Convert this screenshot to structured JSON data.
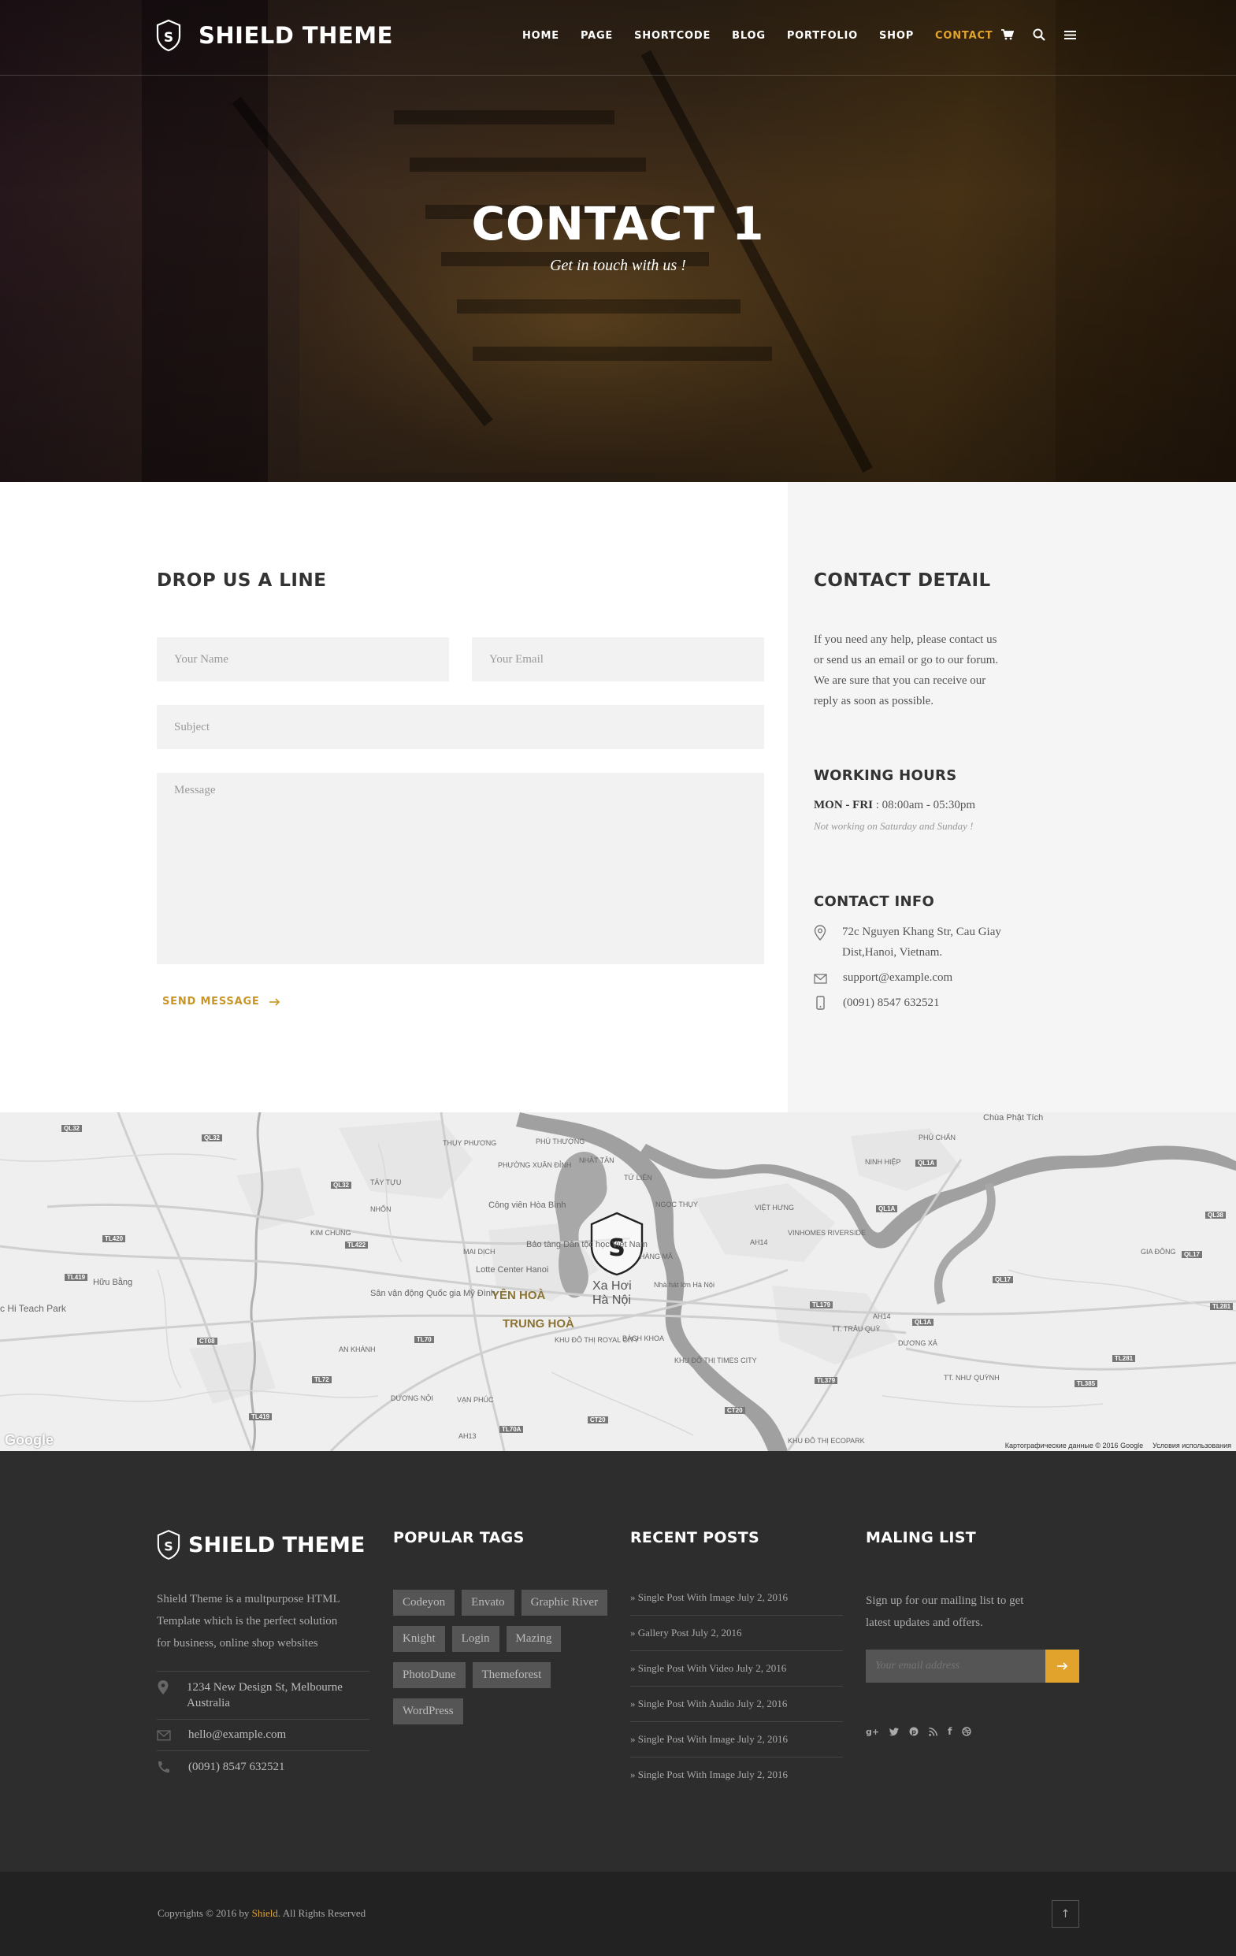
{
  "header": {
    "brand": "SHIELD THEME",
    "nav": [
      {
        "label": "HOME",
        "active": false
      },
      {
        "label": "PAGE",
        "active": false
      },
      {
        "label": "SHORTCODE",
        "active": false
      },
      {
        "label": "BLOG",
        "active": false
      },
      {
        "label": "PORTFOLIO",
        "active": false
      },
      {
        "label": "SHOP",
        "active": false
      },
      {
        "label": "CONTACT",
        "active": true
      }
    ],
    "icons": [
      "cart-icon",
      "search-icon",
      "menu-icon"
    ]
  },
  "hero": {
    "title": "CONTACT 1",
    "subtitle": "Get in touch with us !"
  },
  "form": {
    "heading": "DROP US A LINE",
    "name_placeholder": "Your Name",
    "email_placeholder": "Your Email",
    "subject_placeholder": "Subject",
    "message_placeholder": "Message",
    "send_label": "SEND MESSAGE"
  },
  "contact_detail": {
    "heading": "CONTACT DETAIL",
    "intro_lines": [
      "If you need any help, please contact us",
      "or send us an email or go to our forum.",
      "We are sure that you can receive our",
      "reply as soon as possible."
    ],
    "hours_heading": "WORKING HOURS",
    "hours_days": "MON - FRI",
    "hours_time": " : 08:00am - 05:30pm",
    "hours_note": "Not working on Saturday and Sunday !",
    "info_heading": "CONTACT INFO",
    "address_line1": "72c Nguyen Khang Str, Cau Giay",
    "address_line2": "Dist,Hanoi, Vietnam.",
    "email": "support@example.com",
    "phone": "(0091) 8547 632521"
  },
  "map": {
    "labels": {
      "city": "Hà Nội",
      "city_alt": "Xa Hơi",
      "yen_hoa": "YÊN HOÀ",
      "trung_hoa": "TRUNG HOÀ",
      "huu_bang": "Hữu Bằng",
      "teach_park": "c Hi Teach Park",
      "chua_phat_tich": "Chùa Phật Tích",
      "phu_chan": "PHÙ CHẨN",
      "cong_vien": "Công viên Hòa Bình",
      "bao_tang": "Bảo tàng Dân tộc học Việt Nam",
      "lotte": "Lotte Center Hanoi",
      "san_van_dong": "Sân vận động Quốc gia Mỹ Đình",
      "viet_hung": "VIỆT HƯNG",
      "ninh_hiep": "NINH HIỆP",
      "gia_dong": "GIA ĐÔNG",
      "duong_xa": "DƯƠNG XÁ",
      "bach_khoa": "BÁCH KHOA",
      "an_khanh": "AN KHÁNH",
      "van_phuc": "VẠN PHÚC",
      "kim_chung": "KIM CHUNG",
      "tay_tuu": "TÂY TỰU",
      "mai_dich": "MAI DỊCH",
      "phu_thuong": "PHÚ THƯỢNG",
      "nhat_tan": "NHẬT TÂN",
      "tu_lien": "TỨ LIÊN",
      "ngoc_thuy": "NGỌC THỤY",
      "vinhomes": "VINHOMES RIVERSIDE",
      "khu_do_thi": "KHU ĐÔ THỊ ROYAL CITY",
      "times_city": "KHU ĐÔ THỊ TIMES CITY",
      "ecopark": "KHU ĐÔ THỊ ECOPARK",
      "tt_trau_quy": "TT. TRÂU QUỲ",
      "tt_nhu_quynh": "TT. NHƯ QUỲNH",
      "duong_noi": "DƯƠNG NỘI",
      "nhon": "NHỔN",
      "thuy_phuong": "THỤY PHƯƠNG",
      "phuong_xuan_dinh": "PHƯỜNG XUÂN ĐỈNH",
      "hang_ma": "HÀNG MÃ",
      "opera": "Nhà hát lớn Hà Nội"
    },
    "road_badges": [
      "QL32",
      "QL32",
      "QL32",
      "TL420",
      "TL422",
      "TL419",
      "CT08",
      "TL70",
      "TL72",
      "TL419",
      "TL70A",
      "CT20",
      "CT20",
      "QL1A",
      "QL1A",
      "TL179",
      "QL1A",
      "QL17",
      "TL179",
      "TL379",
      "TL281",
      "TL385",
      "TL386",
      "QL38",
      "QL17",
      "TL281",
      "AH14",
      "AH14",
      "AH13",
      "QL17"
    ],
    "attribution": "Картографические данные © 2016 Google",
    "terms": "Условия использования",
    "google_logo": "Google"
  },
  "footer": {
    "brand": "SHIELD THEME",
    "about_lines": [
      "Shield Theme is a multpurpose HTML",
      "Template which is the perfect solution",
      "for business, online shop websites"
    ],
    "address_line1": "1234 New Design St, Melbourne",
    "address_line2": "Australia",
    "email": "hello@example.com",
    "phone": "(0091) 8547 632521",
    "tags_title": "POPULAR TAGS",
    "tags": [
      "Codeyon",
      "Envato",
      "Graphic River",
      "Knight",
      "Login",
      "Mazing",
      "PhotoDune",
      "Themeforest",
      "WordPress"
    ],
    "posts_title": "RECENT POSTS",
    "posts": [
      "Single Post With Image July 2, 2016",
      "Gallery Post July 2, 2016",
      "Single Post With Video July 2, 2016",
      "Single Post With Audio July 2, 2016",
      "Single Post With Image July 2, 2016",
      "Single Post With Image July 2, 2016"
    ],
    "mailing_title": "MALING LIST",
    "mailing_lines": [
      "Sign up for our mailing list to get",
      "latest updates and offers."
    ],
    "mailing_placeholder": "Your email address",
    "social_icons": [
      "google-plus-icon",
      "twitter-icon",
      "pinterest-icon",
      "rss-icon",
      "facebook-icon",
      "dribbble-icon"
    ]
  },
  "bottom_bar": {
    "copy_prefix": "Copyrights © 2016 by ",
    "copy_brand": "Shield",
    "copy_suffix": ". All Rights Reserved",
    "to_top_glyph": "↑"
  },
  "colors": {
    "accent": "#e1a32c",
    "footer_bg": "#2d2d2d",
    "bottom_bg": "#222222",
    "panel_bg": "#f5f5f5"
  }
}
